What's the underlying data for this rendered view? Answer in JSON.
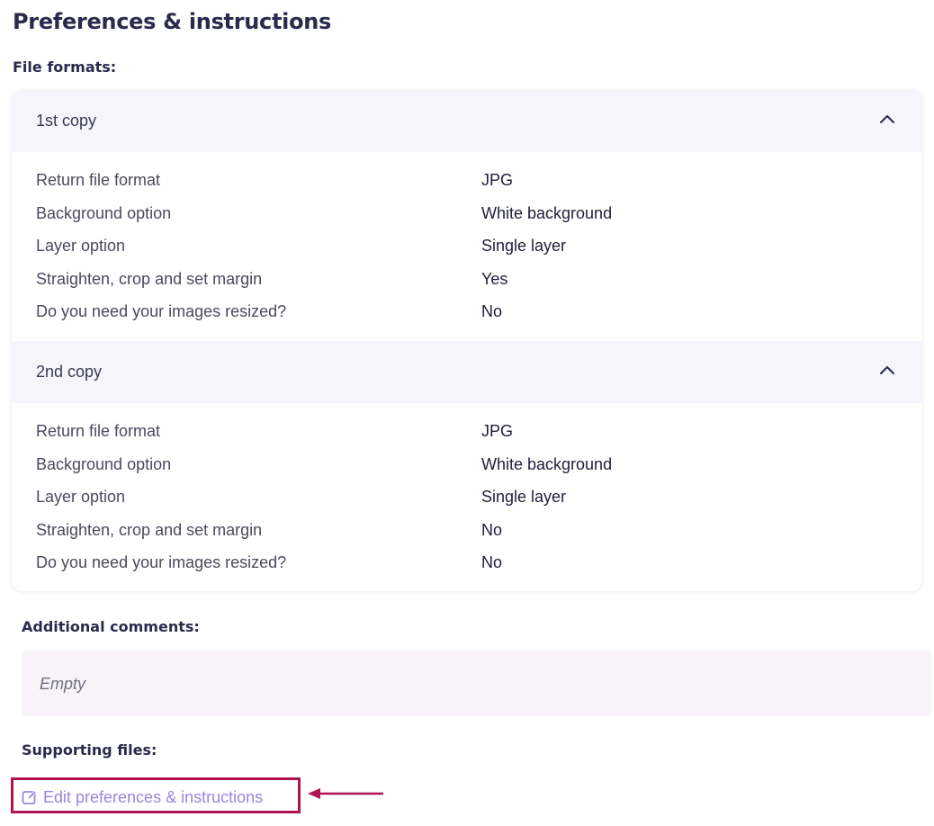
{
  "page_title": "Preferences & instructions",
  "file_formats": {
    "label": "File formats:",
    "copies": [
      {
        "title": "1st copy",
        "rows": [
          {
            "label": "Return file format",
            "value": "JPG"
          },
          {
            "label": "Background option",
            "value": "White background"
          },
          {
            "label": "Layer option",
            "value": "Single layer"
          },
          {
            "label": "Straighten, crop and set margin",
            "value": "Yes"
          },
          {
            "label": "Do you need your images resized?",
            "value": "No"
          }
        ]
      },
      {
        "title": "2nd copy",
        "rows": [
          {
            "label": "Return file format",
            "value": "JPG"
          },
          {
            "label": "Background option",
            "value": "White background"
          },
          {
            "label": "Layer option",
            "value": "Single layer"
          },
          {
            "label": "Straighten, crop and set margin",
            "value": "No"
          },
          {
            "label": "Do you need your images resized?",
            "value": "No"
          }
        ]
      }
    ]
  },
  "additional_comments": {
    "label": "Additional comments:",
    "value": "Empty"
  },
  "supporting_files": {
    "label": "Supporting files:"
  },
  "edit_link": {
    "label": "Edit preferences & instructions",
    "icon": "edit-icon"
  },
  "colors": {
    "accent_link": "#9b84e0",
    "highlight_border": "#b0134f",
    "header_bg": "#f5f5fb",
    "comments_bg": "#f7f3f9"
  }
}
